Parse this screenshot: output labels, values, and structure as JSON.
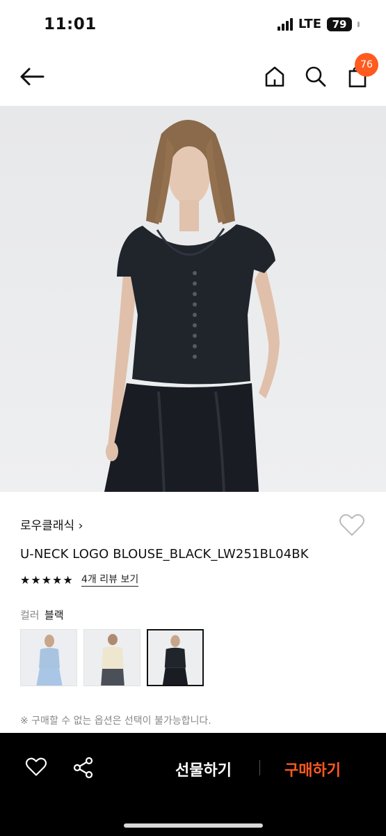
{
  "status_bar": {
    "time": "11:01",
    "network": "LTE",
    "battery": "79"
  },
  "header": {
    "cart_count": "76"
  },
  "product": {
    "brand": "로우클래식 ›",
    "title": "U-NECK LOGO BLOUSE_BLACK_LW251BL04BK",
    "rating_stars": "★★★★★",
    "review_link": "4개 리뷰 보기",
    "color_label": "컬러",
    "color_value": "블랙",
    "option_notice": "※ 구매할 수 없는 옵션은 선택이 불가능합니다."
  },
  "bottom_bar": {
    "gift_label": "선물하기",
    "buy_label": "구매하기"
  },
  "colors": {
    "accent": "#ff5a1f",
    "bottom_bar_bg": "#000000"
  }
}
